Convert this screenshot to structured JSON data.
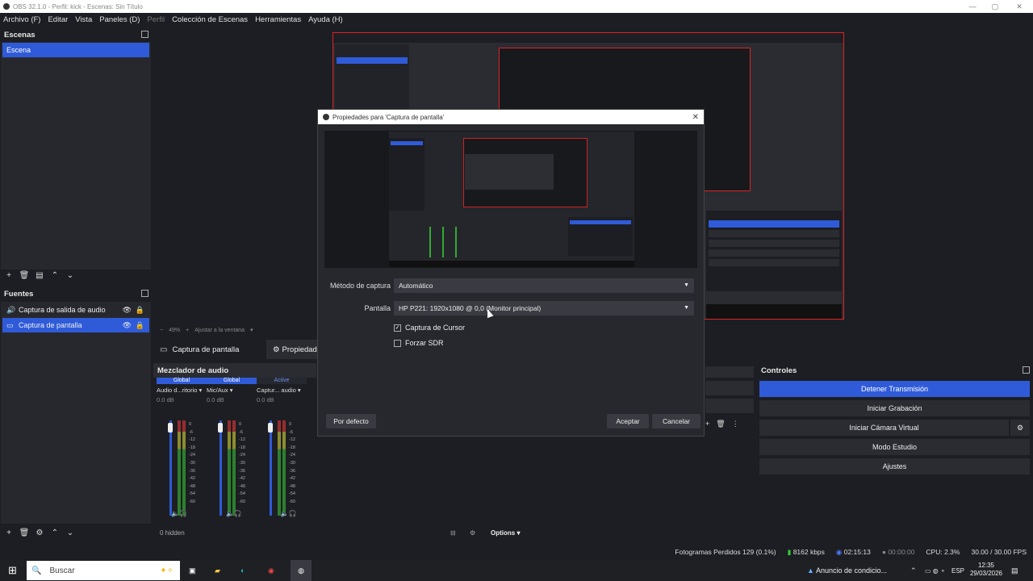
{
  "window": {
    "title": "OBS 32.1.0 - Perfil: kick - Escenas: Sin Título"
  },
  "menu": [
    "Archivo (F)",
    "Editar",
    "Vista",
    "Paneles (D)",
    "Perfil",
    "Colección de Escenas",
    "Herramientas",
    "Ayuda (H)"
  ],
  "scenes": {
    "title": "Escenas",
    "items": [
      "Escena"
    ]
  },
  "sources": {
    "title": "Fuentes",
    "items": [
      "Captura de salida de audio",
      "Captura de pantalla"
    ]
  },
  "preview": {
    "zoom": "49%",
    "fit_label": "Ajustar a la ventana"
  },
  "source_bar": {
    "selected": "Captura de pantalla",
    "properties_label": "Propiedad"
  },
  "mixer": {
    "title": "Mezclador de audio",
    "channels": [
      {
        "tag": "Global",
        "name": "Audio d...ritorio",
        "db": "0.0 dB"
      },
      {
        "tag": "Global",
        "name": "Mic/Aux",
        "db": "0.0 dB"
      },
      {
        "tag": "Active",
        "name": "Captur... audio",
        "db": "0.0 dB"
      }
    ],
    "scale": [
      "0",
      "-6",
      "-12",
      "-18",
      "-24",
      "-30",
      "-36",
      "-42",
      "-48",
      "-54",
      "-60"
    ],
    "hidden": "0 hidden",
    "options": "Options"
  },
  "controls": {
    "title": "Controles",
    "buttons": [
      "Detener Transmisión",
      "Iniciar Grabación",
      "Iniciar Cámara Virtual",
      "Modo Estudio",
      "Ajustes"
    ]
  },
  "status": {
    "frames": "Fotogramas Perdidos 129 (0.1%)",
    "bitrate": "8162 kbps",
    "stream_time": "02:15:13",
    "rec_time": "00:00:00",
    "cpu": "CPU: 2.3%",
    "fps": "30.00 / 30.00 FPS"
  },
  "dialog": {
    "title": "Propiedades para 'Captura de pantalla'",
    "method_label": "Método de captura",
    "method_value": "Automático",
    "screen_label": "Pantalla",
    "screen_value": "HP P221: 1920x1080 @ 0,0 (Monitor principal)",
    "cursor_label": "Captura de Cursor",
    "sdr_label": "Forzar SDR",
    "defaults": "Por defecto",
    "accept": "Aceptar",
    "cancel": "Cancelar"
  },
  "taskbar": {
    "search": "Buscar",
    "news": "Anuncio de condicio...",
    "lang": "ESP",
    "time": "12:35",
    "date": "29/03/2026"
  },
  "colors": {
    "accent": "#2f5bd8",
    "preview_border": "#dd2222"
  }
}
